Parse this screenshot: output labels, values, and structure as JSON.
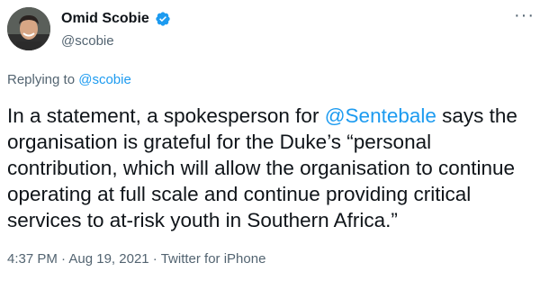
{
  "author": {
    "display_name": "Omid Scobie",
    "handle": "@scobie",
    "verified_icon": "verified-badge-icon",
    "avatar_icon": "avatar-photo"
  },
  "more_menu": {
    "label": "···",
    "icon": "more-icon"
  },
  "reply_context": {
    "prefix": "Replying to ",
    "mention": "@scobie"
  },
  "tweet": {
    "text_before": "In a statement, a spokesperson for ",
    "mention": "@Sentebale",
    "text_after": " says the organisation is grateful for the Duke’s “personal contribution, which will allow the organisation to continue operating at full scale and continue providing critical services to at-risk youth in Southern Africa.”"
  },
  "meta": {
    "time": "4:37 PM",
    "separator": " · ",
    "date": "Aug 19, 2021",
    "source": "Twitter for iPhone"
  },
  "colors": {
    "link": "#1d9bf0",
    "secondary_text": "#536471",
    "primary_text": "#0f1419",
    "verified": "#1d9bf0"
  }
}
